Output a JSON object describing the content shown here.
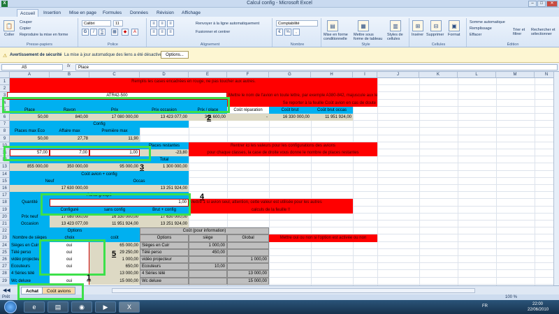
{
  "window": {
    "title": "Calcul config - Microsoft Excel",
    "app_icon": "excel-icon"
  },
  "tabs": [
    "Accueil",
    "Insertion",
    "Mise en page",
    "Formules",
    "Données",
    "Révision",
    "Affichage"
  ],
  "ribbon": {
    "clipboard": {
      "paste": "Coller",
      "cut": "Couper",
      "copy": "Copier",
      "format_painter": "Reproduire la mise en forme",
      "label": "Presse-papiers"
    },
    "font": {
      "name": "Calibri",
      "size": "11",
      "label": "Police"
    },
    "alignment": {
      "wrap": "Renvoyer à la ligne automatiquement",
      "merge": "Fusionner et centrer",
      "label": "Alignement"
    },
    "number": {
      "format": "Comptabilité",
      "label": "Nombre"
    },
    "style": {
      "conditional": "Mise en forme conditionnelle",
      "table": "Mettre sous forme de tableau",
      "cell_styles": "Styles de cellules",
      "label": "Style"
    },
    "cells": {
      "insert": "Insérer",
      "delete": "Supprimer",
      "format": "Format",
      "label": "Cellules"
    },
    "editing": {
      "autosum": "Somme automatique",
      "fill": "Remplissage",
      "clear": "Effacer",
      "sort": "Trier et filtrer",
      "find": "Rechercher et sélectionner",
      "label": "Édition"
    }
  },
  "security": {
    "title": "Avertissement de sécurité",
    "message": "La mise à jour automatique des liens a été désactivée",
    "button": "Options..."
  },
  "formula_bar": {
    "cell": "A5",
    "fx": "fx",
    "value": "Place"
  },
  "columns": [
    "A",
    "B",
    "C",
    "D",
    "E",
    "F",
    "G",
    "H",
    "I",
    "J",
    "K",
    "L",
    "M",
    "N"
  ],
  "rows": [
    "1",
    "2",
    "3",
    "4",
    "5",
    "6",
    "7",
    "8",
    "9",
    "10",
    "11",
    "12",
    "13",
    "14",
    "15",
    "16",
    "17",
    "18",
    "19",
    "20",
    "21",
    "22",
    "23",
    "24",
    "25",
    "26",
    "27",
    "28",
    "29"
  ],
  "cells": {
    "r1": "Remplis les cases encadrées en rouge, ne pas toucher aux autres.",
    "r3_aircraft": "ATR42-500",
    "r3_note": "Mettre le nom de l'avion en toute lettre, par exemple A380-842, majuscule aux lettres.",
    "r4_note": "Se reporter à la feuille Coût avion en cas de doute",
    "r5": [
      "Place",
      "Rayon",
      "Prix",
      "Prix occasion",
      "Prix / place",
      "Coût réparation",
      "Coût brut",
      "Coût brut occas"
    ],
    "r6": [
      "50,00",
      "840,00",
      "17 080 000,00",
      "13 423 077,00",
      "341 600,00",
      "-",
      "16 330 000,00",
      "11 951 924,00"
    ],
    "r7": "Config",
    "r8": [
      "Places max Eco",
      "Affaire max",
      "Première max"
    ],
    "r9": [
      "50,00",
      "27,78",
      "11,90"
    ],
    "r10": "Places restantes",
    "r10_note": "Rentrer ici les valeurs pour les configurations des avions",
    "r11": [
      "57,00",
      "7,00",
      "1,00",
      "-23,80"
    ],
    "r11_note": "pour chaque classes, la case de droite vous donne le nombre de places restantes",
    "r12": "Total",
    "r13": [
      "855 000,00",
      "350 000,00",
      "95 000,00",
      "1 300 000,00"
    ],
    "r14": "Coût avion + config",
    "r15": [
      "Neuf",
      "Occas"
    ],
    "r16": [
      "17 630 000,00",
      "13 251 924,00"
    ],
    "r17": "Achat groupé",
    "r18": [
      "Quantité",
      "1,00"
    ],
    "r18_note": "Mettre 1 si avion seul, attention, cette valeur est utilisée pour les autres",
    "r19_note": "calculs de la feuille !!",
    "r19": [
      "Configuré",
      "sans config",
      "Brut + config"
    ],
    "r20": [
      "Prix neuf",
      "17 080 000,00",
      "16 330 000,00",
      "17 630 000,00"
    ],
    "r21": [
      "Occasion",
      "13 423 077,00",
      "11 951 924,00",
      "13 251 924,00"
    ],
    "r22": [
      "Options",
      "Coût (pour information)"
    ],
    "r23": [
      "Nombre de sièges",
      "choix",
      "coût",
      "Options",
      "siège",
      "Global"
    ],
    "r23_note": "Mettre oui ou non si l'option est activée ou non",
    "r24": [
      "Sièges en Cuir",
      "oui",
      "65 000,00",
      "Sièges en Cuir",
      "1 000,00",
      ""
    ],
    "r25": [
      "Télé perso",
      "oui",
      "29 250,00",
      "Télé perso",
      "450,00",
      ""
    ],
    "r26": [
      "vidéo projecteur",
      "oui",
      "1 000,00",
      "vidéo projecteur",
      "",
      "1 000,00"
    ],
    "r27": [
      "Ecouteurs",
      "oui",
      "650,00",
      "Ecouteurs",
      "10,00",
      ""
    ],
    "r28": [
      "4 Séries télé",
      "",
      "13 000,00",
      "4 Séries télé",
      "",
      "13 000,00"
    ],
    "r29": [
      "Wc deluxe",
      "oui",
      "15 000,00",
      "Wc deluxe",
      "",
      "15 000,00"
    ]
  },
  "annotations": [
    "1",
    "2",
    "3",
    "4",
    "5"
  ],
  "sheets": [
    "Achat",
    "Coût avions"
  ],
  "status": {
    "text": "Prêt",
    "zoom": "100 %"
  },
  "taskbar": {
    "lang": "FR",
    "time": "22:00",
    "date": "22/06/2010"
  },
  "colors": {
    "highlight": "#3de04a",
    "header_blue": "#00b0f0",
    "note_red": "#ff0000"
  }
}
